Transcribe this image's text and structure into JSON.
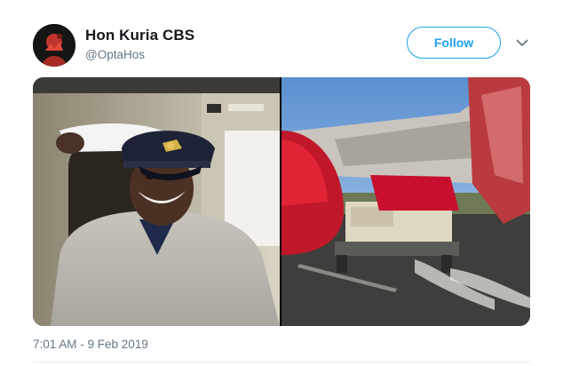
{
  "author": {
    "display_name": "Hon Kuria CBS",
    "handle": "@OptaHos"
  },
  "follow_label": "Follow",
  "media": {
    "count": 2
  },
  "timestamp": "7:01 AM - 9 Feb 2019",
  "colors": {
    "accent": "#1da1f2",
    "secondary_text": "#657786",
    "primary_text": "#14171a"
  },
  "icons": {
    "menu": "chevron-down-icon"
  }
}
